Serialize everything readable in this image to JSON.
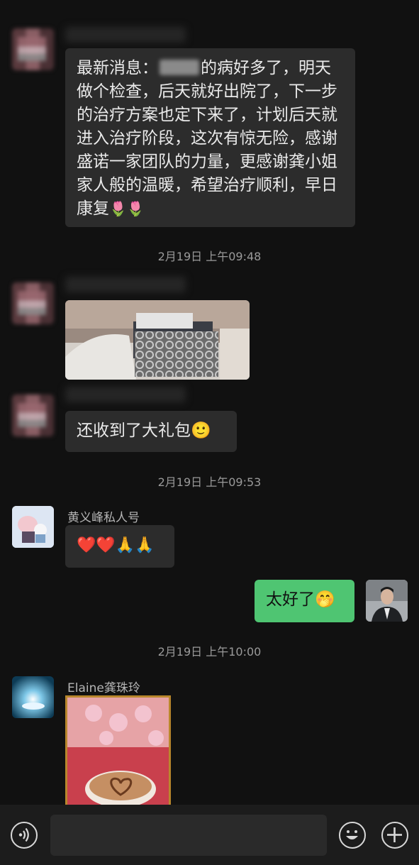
{
  "messages": [
    {
      "id": "m1",
      "sender_blurred": true,
      "text_prefix": "最新消息：",
      "text_rest": "的病好多了，明天做个检查，后天就好出院了，下一步的治疗方案也定下来了，计划后天就进入治疗阶段，这次有惊无险，感谢盛诺一家团队的力量，更感谢龚小姐家人般的温暖，希望治疗顺利，早日康复",
      "emoji": "🌷🌷"
    },
    {
      "id": "t1",
      "timestamp": "2月19日 上午09:48"
    },
    {
      "id": "m2",
      "sender_blurred": true,
      "type": "image",
      "image_desc": "gift-basket-photo"
    },
    {
      "id": "m3",
      "sender_blurred": true,
      "text": "还收到了大礼包",
      "emoji": "🙂"
    },
    {
      "id": "t2",
      "timestamp": "2月19日 上午09:53"
    },
    {
      "id": "m4",
      "sender": "黄义峰私人号",
      "emoji": "❤️❤️🙏🙏"
    },
    {
      "id": "m5",
      "mine": true,
      "text": "太好了",
      "emoji": "🤭"
    },
    {
      "id": "t3",
      "timestamp": "2月19日 上午10:00"
    },
    {
      "id": "m6",
      "sender": "Elaine龚珠玲",
      "type": "image",
      "image_desc": "coffee-orchid-photo"
    }
  ],
  "input_bar": {
    "voice_icon": "voice-icon",
    "emoji_icon": "emoji-icon",
    "plus_icon": "plus-icon"
  }
}
